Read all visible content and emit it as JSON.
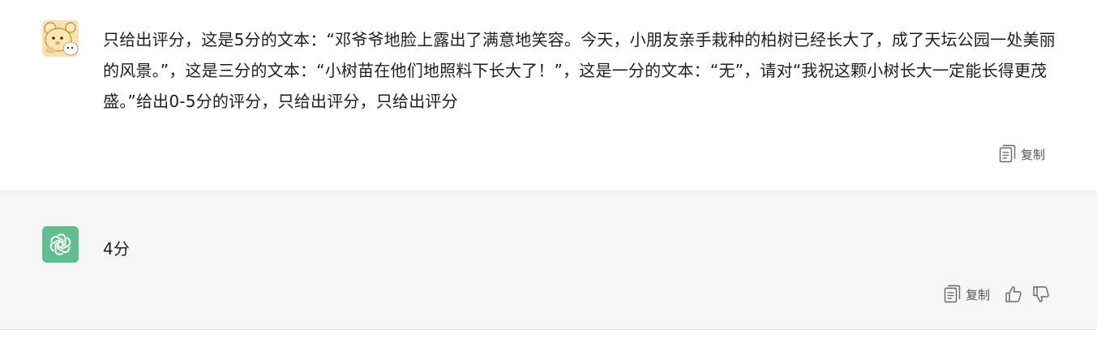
{
  "messages": {
    "user": {
      "text": "只给出评分，这是5分的文本：“邓爷爷地脸上露出了满意地笑容。今天，小朋友亲手栽种的柏树已经长大了，成了天坛公园一处美丽的风景。”，这是三分的文本：“小树苗在他们地照料下长大了！”，这是一分的文本：“无”，请对“我祝这颗小树长大一定能长得更茂盛。”给出0-5分的评分，只给出评分，只给出评分",
      "copy_label": "复制"
    },
    "assistant": {
      "text": "4分",
      "copy_label": "复制"
    }
  },
  "colors": {
    "assistant_avatar_bg": "#5fbf8f",
    "assistant_bg": "#f6f6f6",
    "user_avatar_bg": "#f8e2b4",
    "divider": "#e4e4e4",
    "text": "#1f1f1f"
  },
  "icons": {
    "user_avatar": "cartoon-bear-avatar",
    "assistant_avatar": "openai-logo-icon",
    "copy": "copy-icon",
    "thumbs_up": "thumbs-up-icon",
    "thumbs_down": "thumbs-down-icon"
  }
}
